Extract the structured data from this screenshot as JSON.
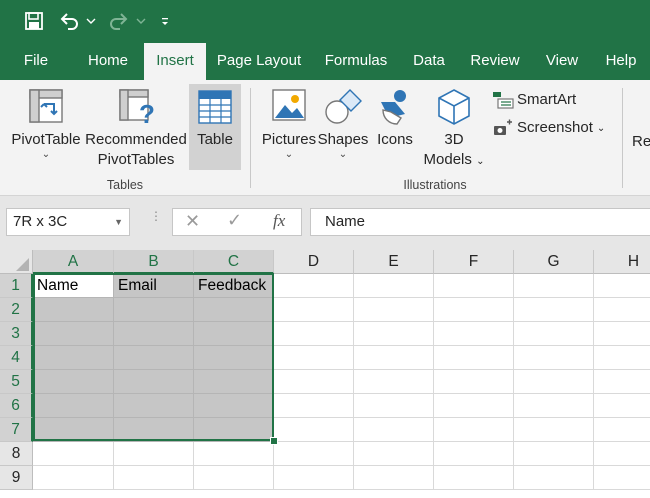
{
  "qat": {
    "icons": [
      "save-icon",
      "undo-icon",
      "redo-icon",
      "customize-qat-icon"
    ]
  },
  "tabs": [
    {
      "label": "File"
    },
    {
      "label": "Home"
    },
    {
      "label": "Insert",
      "active": true
    },
    {
      "label": "Page Layout"
    },
    {
      "label": "Formulas"
    },
    {
      "label": "Data"
    },
    {
      "label": "Review"
    },
    {
      "label": "View"
    },
    {
      "label": "Help"
    }
  ],
  "ribbon": {
    "groups": {
      "tables": "Tables",
      "illustrations": "Illustrations"
    },
    "pivottable": "PivotTable",
    "recommended_line1": "Recommended",
    "recommended_line2": "PivotTables",
    "table": "Table",
    "pictures": "Pictures",
    "shapes": "Shapes",
    "icons": "Icons",
    "models_line1": "3D",
    "models_line2": "Models",
    "smartart": "SmartArt",
    "screenshot": "Screenshot",
    "overflow": "Re"
  },
  "formula_bar": {
    "name_box": "7R x 3C",
    "fx": "fx",
    "formula": "Name"
  },
  "grid": {
    "columns": [
      "A",
      "B",
      "C",
      "D",
      "E",
      "F",
      "G",
      "H"
    ],
    "rows": [
      "1",
      "2",
      "3",
      "4",
      "5",
      "6",
      "7",
      "8",
      "9"
    ],
    "row1": [
      "Name",
      "Email",
      "Feedback"
    ],
    "accent": "#217346",
    "selection_fill": "#c6c6c6"
  }
}
